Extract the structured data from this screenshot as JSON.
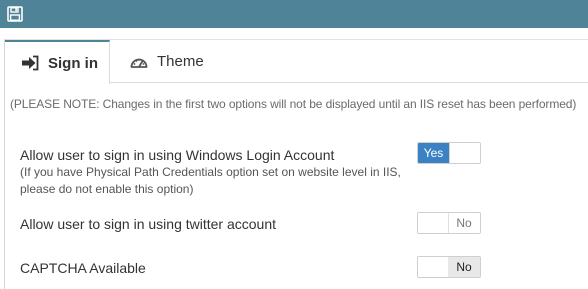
{
  "toolbar": {
    "save_icon": "floppy-disk-icon",
    "background": "#4f8398"
  },
  "tabs": [
    {
      "label": "Sign in",
      "icon": "sign-in-icon",
      "active": true
    },
    {
      "label": "Theme",
      "icon": "dashboard-icon",
      "active": false
    }
  ],
  "note": "(PLEASE NOTE: Changes in the first two options will not be displayed until an IIS reset has been performed)",
  "options": [
    {
      "label": "Allow user to sign in using Windows Login Account",
      "sub1": "(If you have Physical Path Credentials option set on website level in IIS,",
      "sub2": "please do not enable this option)",
      "toggle_text": "Yes",
      "enabled": true
    },
    {
      "label": "Allow user to sign in using twitter account",
      "toggle_text": "No",
      "enabled": false
    },
    {
      "label": "CAPTCHA Available",
      "toggle_text": "No",
      "enabled": false
    }
  ],
  "colors": {
    "accent": "#3b82c4",
    "toolbar": "#4f8398"
  }
}
